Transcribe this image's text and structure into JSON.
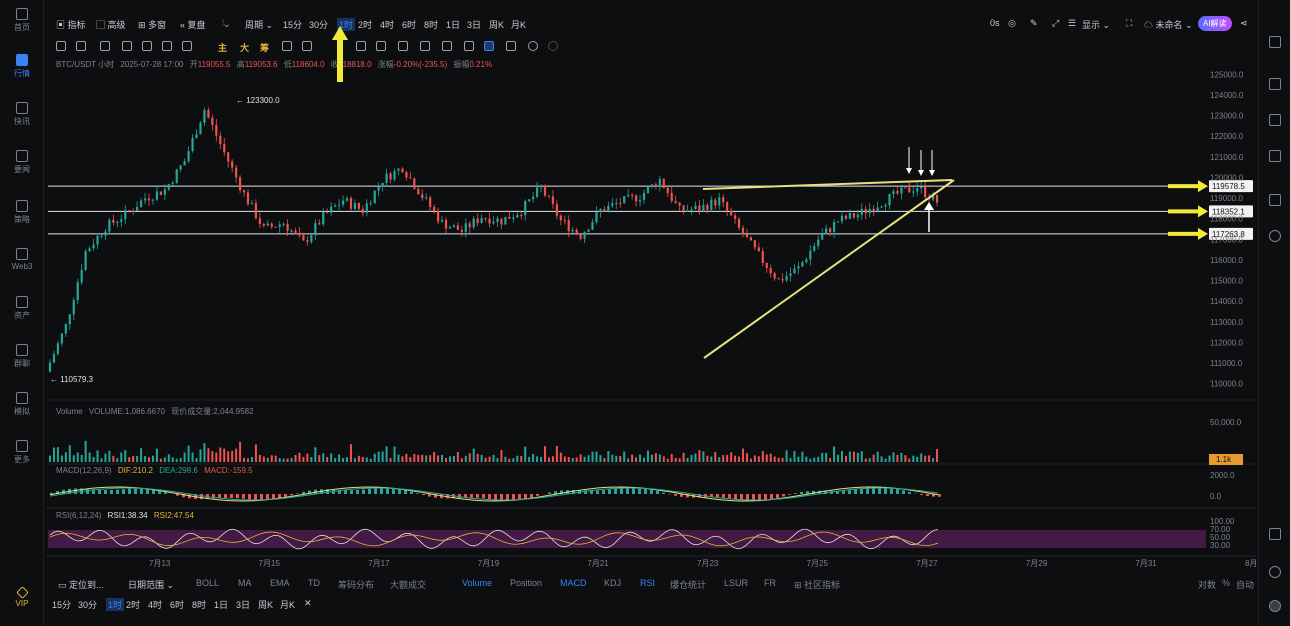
{
  "sidebar": {
    "items": [
      {
        "label": "首页",
        "icon": "home-icon"
      },
      {
        "label": "行情",
        "icon": "chart-icon",
        "active": true
      },
      {
        "label": "快讯",
        "icon": "news-icon"
      },
      {
        "label": "要闻",
        "icon": "doc-icon"
      },
      {
        "label": "策略",
        "icon": "strategy-icon"
      },
      {
        "label": "Web3",
        "icon": "web3-icon"
      },
      {
        "label": "资产",
        "icon": "wallet-icon"
      },
      {
        "label": "群聊",
        "icon": "chat-icon"
      },
      {
        "label": "模拟",
        "icon": "sim-icon"
      },
      {
        "label": "更多",
        "icon": "more-icon"
      }
    ],
    "vip": "VIP"
  },
  "topbar": {
    "indicators": "指标",
    "advanced": "高级",
    "multi": "多窗",
    "review": "复盘",
    "period": "周期",
    "intervals": [
      "15分",
      "30分",
      "1时",
      "2时",
      "4时",
      "6时",
      "8时",
      "1日",
      "3日",
      "周K",
      "月K"
    ],
    "active_interval": "1时",
    "right": {
      "time": "0s",
      "display": "显示",
      "unnamed": "未命名",
      "ai": "AI解读"
    }
  },
  "toolbar2": {
    "main": "主",
    "big": "大",
    "chips": "筹"
  },
  "legend": {
    "symbol": "BTC/USDT 小时",
    "date": "2025-07-28 17:00",
    "open_label": "开",
    "open": "119055.5",
    "high_label": "高",
    "high": "119053.6",
    "low_label": "低",
    "low": "118604.0",
    "close_label": "收",
    "close": "118818.0",
    "change_label": "涨幅",
    "change": "-0.20%(-235.5)",
    "amp_label": "振幅",
    "amp": "0.21%"
  },
  "chart_data": {
    "type": "candlestick",
    "symbol": "BTC/USDT",
    "interval": "1时",
    "x_labels": [
      "7月13",
      "7月15",
      "7月17",
      "7月19",
      "7月21",
      "7月23",
      "7月25",
      "7月27",
      "7月29",
      "7月31",
      "8月2"
    ],
    "y_ticks": [
      "125000.0",
      "124000.0",
      "123000.0",
      "122000.0",
      "121000.0",
      "120000.0",
      "119000.0",
      "118000.0",
      "117000.0",
      "116000.0",
      "115000.0",
      "114000.0",
      "113000.0",
      "112000.0",
      "111000.0",
      "110000.0"
    ],
    "ylim": [
      109500,
      125500
    ],
    "annotations": {
      "high": "123300.0",
      "low": "110579.3"
    },
    "levels": [
      {
        "value": 119578.5,
        "label": "119578.5"
      },
      {
        "value": 118352.1,
        "label": "118352.1"
      },
      {
        "value": 117263.8,
        "label": "117263.8"
      }
    ],
    "close_path": [
      [
        "7月12",
        110579
      ],
      [
        "7月12",
        112800
      ],
      [
        "7月12",
        116400
      ],
      [
        "7月13",
        117600
      ],
      [
        "7月13",
        118200
      ],
      [
        "7月14",
        119000
      ],
      [
        "7月14",
        119400
      ],
      [
        "7月14",
        120800
      ],
      [
        "7月14",
        123300
      ],
      [
        "7月15",
        121200
      ],
      [
        "7月15",
        119200
      ],
      [
        "7月15",
        117500
      ],
      [
        "7月16",
        117800
      ],
      [
        "7月16",
        116800
      ],
      [
        "7月17",
        118100
      ],
      [
        "7月17",
        118900
      ],
      [
        "7月18",
        118400
      ],
      [
        "7月18",
        119900
      ],
      [
        "7月18",
        120500
      ],
      [
        "7月18",
        119100
      ],
      [
        "7月19",
        117800
      ],
      [
        "7月19",
        117400
      ],
      [
        "7月20",
        118100
      ],
      [
        "7月20",
        117900
      ],
      [
        "7月21",
        118400
      ],
      [
        "7月21",
        119500
      ],
      [
        "7月21",
        117900
      ],
      [
        "7月22",
        117200
      ],
      [
        "7月22",
        118400
      ],
      [
        "7月23",
        118800
      ],
      [
        "7月23",
        119100
      ],
      [
        "7月23",
        119900
      ],
      [
        "7月24",
        118400
      ],
      [
        "7月24",
        118500
      ],
      [
        "7月24",
        118900
      ],
      [
        "7月25",
        117500
      ],
      [
        "7月25",
        116200
      ],
      [
        "7月25",
        115000
      ],
      [
        "7月26",
        115600
      ],
      [
        "7月26",
        117000
      ],
      [
        "7月27",
        117900
      ],
      [
        "7月27",
        118200
      ],
      [
        "7月27",
        118700
      ],
      [
        "7月28",
        119200
      ],
      [
        "7月28",
        119550
      ],
      [
        "7月28",
        118818
      ]
    ],
    "volume": {
      "label": "Volume",
      "value_label": "VOLUME:1,086.6670",
      "extra": "现价成交量:2,044.9582",
      "ticks": [
        "50,000.0",
        "0"
      ],
      "current": "1.1k"
    },
    "macd": {
      "label": "MACD(12,26,9)",
      "dif": "DIF:210.2",
      "dea": "DEA:298.6",
      "macd": "MACD:-159.5",
      "ticks": [
        "2000.0",
        "0.0"
      ]
    },
    "rsi": {
      "label": "RSI(6,12,24)",
      "rsi1": "RSI1:38.34",
      "rsi2": "RSI2:47.54",
      "ticks": [
        "100.00",
        "70.00",
        "50.00",
        "30.00"
      ]
    }
  },
  "bottombar": {
    "locate": "定位到...",
    "range": "日期范围",
    "tabs": [
      "BOLL",
      "MA",
      "EMA",
      "TD",
      "筹码分布",
      "大额成交",
      "Volume",
      "Position",
      "MACD",
      "KDJ",
      "RSI",
      "爆仓统计",
      "LSUR",
      "FR",
      "社区指标"
    ],
    "active_tabs": [
      "Volume",
      "MACD",
      "RSI"
    ],
    "right": {
      "log": "对数",
      "pct": "%",
      "auto": "自动"
    }
  },
  "bottombar2": {
    "intervals": [
      "15分",
      "30分",
      "1时",
      "2时",
      "4时",
      "6时",
      "8时",
      "1日",
      "3日",
      "周K",
      "月K"
    ],
    "active": "1时"
  },
  "colors": {
    "up": "#26a69a",
    "down": "#ef5350",
    "yellow": "#e8e07a",
    "arrow": "#f1ea3a",
    "accent": "#3b82f6"
  }
}
